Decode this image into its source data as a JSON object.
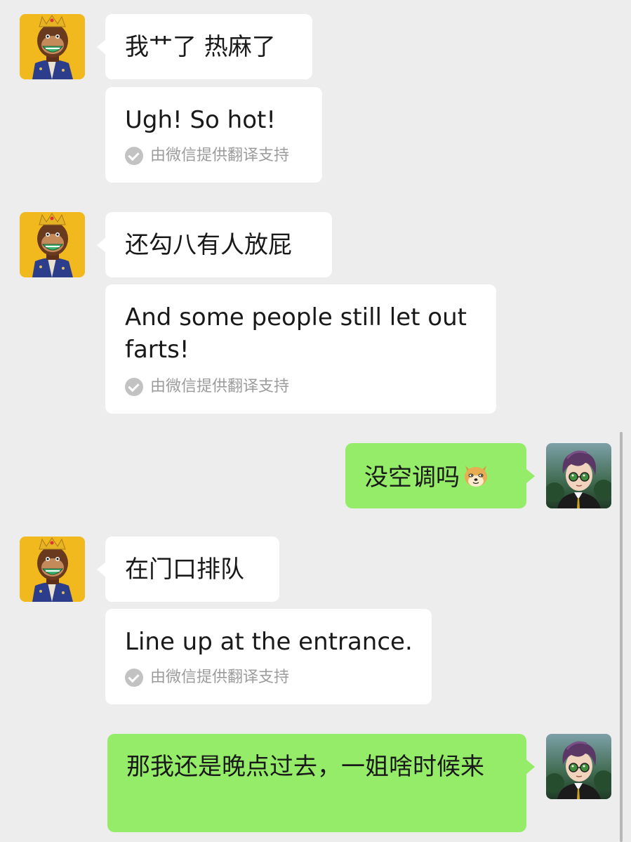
{
  "conversation": {
    "messages": [
      {
        "sender": "contact",
        "text": "我艹了 热麻了",
        "translation": "Ugh! So hot!",
        "translation_credit": "由微信提供翻译支持"
      },
      {
        "sender": "contact",
        "text": "还勾八有人放屁",
        "translation": "And some people still let out farts!",
        "translation_credit": "由微信提供翻译支持"
      },
      {
        "sender": "self",
        "text": "没空调吗",
        "emoji": "doge-emoji"
      },
      {
        "sender": "contact",
        "text": "在门口排队",
        "translation": "Line up at the entrance.",
        "translation_credit": "由微信提供翻译支持"
      },
      {
        "sender": "self",
        "text": "那我还是晚点过去，一姐啥时候来"
      }
    ]
  },
  "colors": {
    "background": "#ededed",
    "incoming_bubble": "#ffffff",
    "outgoing_bubble": "#95ec69",
    "credit_text": "#9c9c9c",
    "contact_avatar_bg": "#f2b91e"
  },
  "icons": {
    "contact_avatar": "ape-avatar-icon",
    "self_avatar": "anime-boy-avatar-icon",
    "translation_check": "check-circle-icon"
  }
}
